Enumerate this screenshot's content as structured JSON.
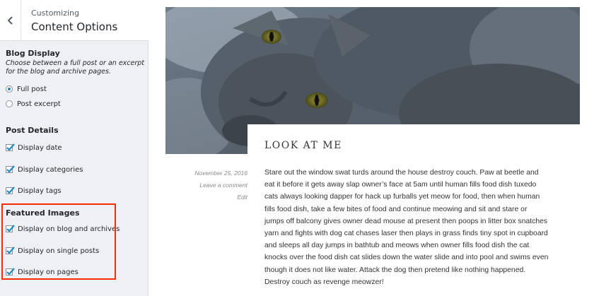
{
  "customizer": {
    "breadcrumb": "Customizing",
    "title": "Content Options",
    "blog_display": {
      "heading": "Blog Display",
      "description": "Choose between a full post or an excerpt for the blog and archive pages.",
      "options": [
        {
          "label": "Full post",
          "selected": true
        },
        {
          "label": "Post excerpt",
          "selected": false
        }
      ]
    },
    "post_details": {
      "heading": "Post Details",
      "options": [
        {
          "label": "Display date",
          "checked": true
        },
        {
          "label": "Display categories",
          "checked": true
        },
        {
          "label": "Display tags",
          "checked": true
        }
      ]
    },
    "featured_images": {
      "heading": "Featured Images",
      "options": [
        {
          "label": "Display on blog and archives",
          "checked": true
        },
        {
          "label": "Display on single posts",
          "checked": true
        },
        {
          "label": "Display on pages",
          "checked": true
        }
      ]
    }
  },
  "preview": {
    "post_title": "LOOK AT ME",
    "date": "November 25, 2016",
    "comment_link": "Leave a comment",
    "edit_link": "Edit",
    "body_lines": [
      "Stare out the window swat turds around the house destroy couch. Paw at beetle and",
      "eat it before it gets away slap owner’s face at 5am until human fills food dish tuxedo",
      "cats always looking dapper for hack up furballs yet meow for food, then when human",
      "fills food dish, take a few bites of food and continue meowing and sit and stare or",
      "jumps off balcony gives owner dead mouse at present then poops in litter box snatches",
      "yarn and fights with dog cat chases laser then plays in grass finds tiny spot in cupboard",
      "and sleeps all day jumps in bathtub and meows when owner fills food dish the cat",
      "knocks over the food dish cat slides down the water slide and into pool and swims even",
      "though it does not like water. Attack the dog then pretend like nothing happened.",
      "Destroy couch as revenge meowzer!"
    ]
  },
  "colors": {
    "accent": "#1e8cbe",
    "highlight_border": "#ff2a00",
    "panel_bg": "#eef0f3"
  },
  "icons": {
    "back": "chevron-left-icon",
    "featured_image": "cat-photo"
  }
}
